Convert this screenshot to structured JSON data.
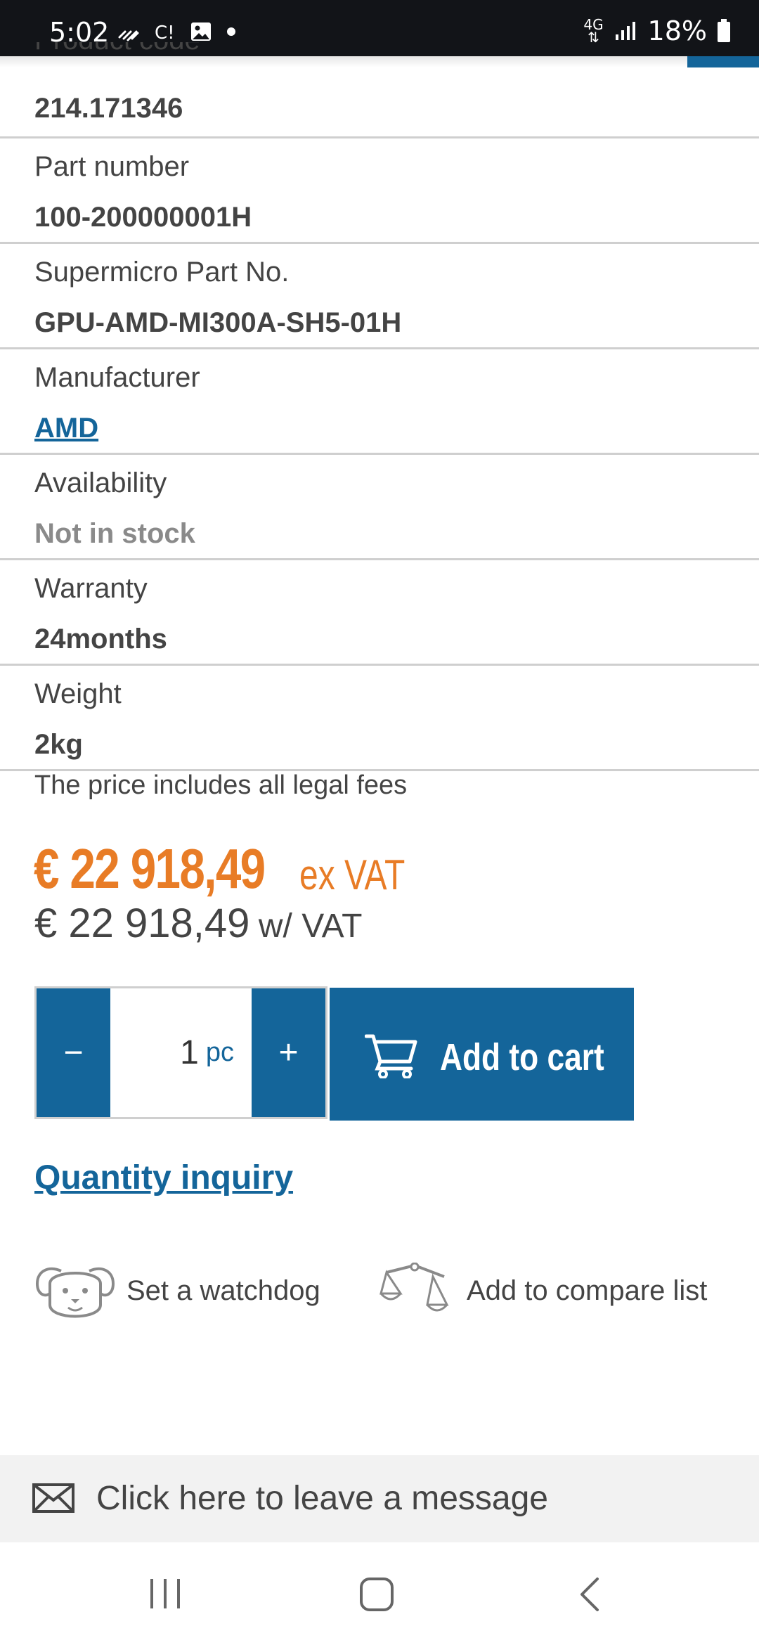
{
  "status_bar": {
    "time": "5:02",
    "network": "4G",
    "battery": "18%",
    "icons": [
      "missed-call-icon",
      "cast-icon",
      "gallery-icon",
      "notification-dot-icon",
      "signal-icon",
      "battery-icon"
    ]
  },
  "specs": [
    {
      "label": "Product code",
      "value": "214.171346",
      "style": "bold"
    },
    {
      "label": "Part number",
      "value": "100-200000001H",
      "style": "bold"
    },
    {
      "label": "Supermicro Part No.",
      "value": "GPU-AMD-MI300A-SH5-01H",
      "style": "bold"
    },
    {
      "label": "Manufacturer",
      "value": "AMD",
      "style": "link"
    },
    {
      "label": "Availability",
      "value": "Not in stock",
      "style": "muted"
    },
    {
      "label": "Warranty",
      "value": "24months",
      "style": "bold"
    },
    {
      "label": "Weight",
      "value": "2kg",
      "style": "bold"
    }
  ],
  "price": {
    "note": "The price includes all legal fees",
    "ex_vat_amount": "€ 22 918,49",
    "ex_vat_label": "ex VAT",
    "with_vat_amount": "€ 22 918,49",
    "with_vat_label": "w/ VAT"
  },
  "quantity": {
    "minus_label": "−",
    "plus_label": "+",
    "value": "1",
    "unit": "pc"
  },
  "add_to_cart": {
    "label": "Add to cart"
  },
  "quantity_inquiry": {
    "label": "Quantity inquiry"
  },
  "actions": {
    "watchdog": "Set a watchdog",
    "compare": "Add to compare list"
  },
  "message_bar": {
    "label": "Click here to leave a message"
  },
  "colors": {
    "brand_blue": "#14659a",
    "price_orange": "#e87c26",
    "status_bar": "#121418"
  }
}
